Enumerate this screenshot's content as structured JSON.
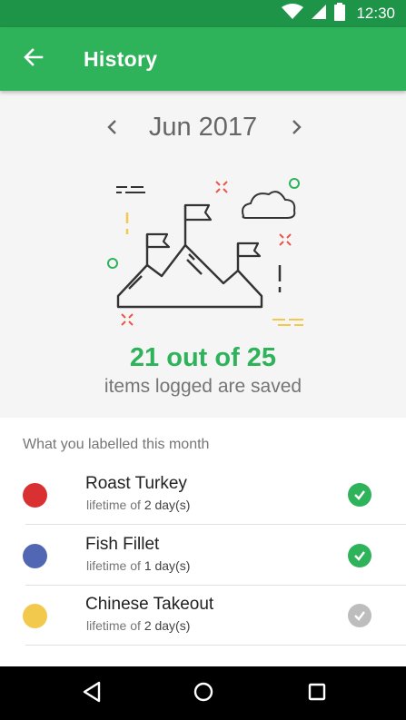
{
  "status_bar": {
    "time": "12:30",
    "icons": [
      "wifi-icon",
      "cellular-signal-icon",
      "battery-icon"
    ]
  },
  "app_bar": {
    "title": "History",
    "back_icon": "arrow-back-icon",
    "color": "#2eb35a"
  },
  "summary": {
    "month": "Jun 2017",
    "prev_icon": "chevron-left-icon",
    "next_icon": "chevron-right-icon",
    "illustration": "mountain-flags-illustration",
    "saved_count": "21 out of 25",
    "saved_caption": "items logged are saved"
  },
  "list": {
    "header": "What you labelled this month",
    "items": [
      {
        "name": "Roast Turkey",
        "lifetime_prefix": "lifetime of",
        "lifetime_value": "2 day(s)",
        "dot_color": "#d93131",
        "status": "saved",
        "check_color": "#2eb35a"
      },
      {
        "name": "Fish Fillet",
        "lifetime_prefix": "lifetime of",
        "lifetime_value": "1 day(s)",
        "dot_color": "#5167b3",
        "status": "saved",
        "check_color": "#2eb35a"
      },
      {
        "name": "Chinese Takeout",
        "lifetime_prefix": "lifetime of",
        "lifetime_value": "2 day(s)",
        "dot_color": "#f2c94c",
        "status": "not-saved",
        "check_color": "#bdbdbd"
      }
    ]
  },
  "nav_bar": {
    "icons": [
      "back-triangle-icon",
      "home-circle-icon",
      "recents-square-icon"
    ]
  }
}
